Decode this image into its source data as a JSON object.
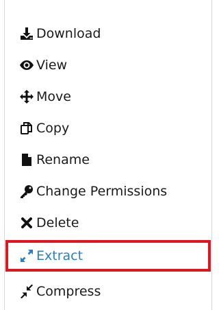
{
  "context_menu": {
    "items": [
      {
        "label": "Download",
        "icon": "download-icon"
      },
      {
        "label": "View",
        "icon": "eye-icon"
      },
      {
        "label": "Move",
        "icon": "move-arrows-icon"
      },
      {
        "label": "Copy",
        "icon": "copy-icon"
      },
      {
        "label": "Rename",
        "icon": "file-icon"
      },
      {
        "label": "Change Permissions",
        "icon": "key-icon"
      },
      {
        "label": "Delete",
        "icon": "x-icon"
      },
      {
        "label": "Extract",
        "icon": "expand-icon"
      },
      {
        "label": "Compress",
        "icon": "compress-icon"
      }
    ],
    "highlighted_item": "Extract",
    "highlight_color": "#e0161f",
    "link_color": "#2a7fc4"
  }
}
